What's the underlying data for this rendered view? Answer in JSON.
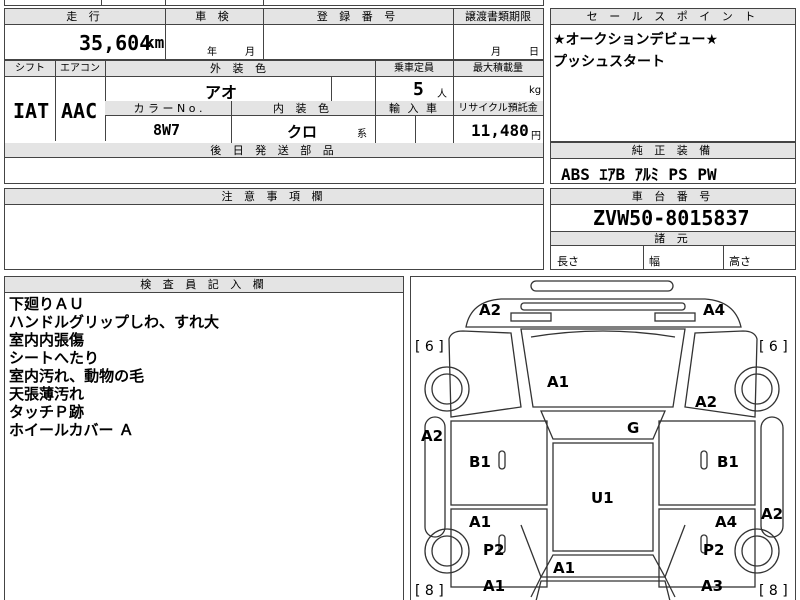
{
  "summary": {
    "mileage_label": "走 行",
    "inspection_label": "車 検",
    "registration_label": "登 録 番 号",
    "transfer_label": "譲渡書類期限",
    "mileage_value": "35,604",
    "mileage_unit": "km",
    "year_unit": "年",
    "month_unit": "月",
    "month_unit2": "月",
    "day_unit": "日"
  },
  "selling_point": {
    "label": "セ ー ル ス ポ イ ン ト",
    "line1": "★オークションデビュー★",
    "line2": "プッシュスタート"
  },
  "spec": {
    "shift_label": "シフト",
    "aircon_label": "エアコン",
    "exterior_color_label": "外 装 色",
    "capacity_label": "乗車定員",
    "max_load_label": "最大積載量",
    "shift_value": "IAT",
    "aircon_value": "AAC",
    "exterior_color_value": "アオ",
    "capacity_value": "5",
    "capacity_unit": "人",
    "max_load_unit": "kg",
    "color_no_label": "カ ラ ー N o .",
    "interior_color_label": "内 装 色",
    "import_label": "輸 入 車",
    "recycle_label": "リサイクル預託金",
    "color_no_value": "8W7",
    "interior_color_value": "クロ",
    "interior_color_suffix": "系",
    "recycle_value": "11,480",
    "recycle_unit": "円",
    "later_parts_label": "後 日 発 送 部 品"
  },
  "equipment": {
    "label": "純 正 装 備",
    "value": "ABS ｴｱB ｱﾙﾐ PS PW"
  },
  "caution": {
    "label": "注 意 事 項 欄"
  },
  "chassis": {
    "label": "車 台 番 号",
    "value": "ZVW50-8015837",
    "dimensions_label": "諸 元",
    "length_label": "長さ",
    "width_label": "幅",
    "height_label": "高さ"
  },
  "inspector": {
    "label": "検 査 員 記 入 欄",
    "notes": [
      "下廻りＡＵ",
      "ハンドルグリップしわ、すれ大",
      "室内内張傷",
      "シートへたり",
      "室内汚れ、動物の毛",
      "天張薄汚れ",
      "タッチＰ跡",
      "ホイールカバー Ａ"
    ]
  },
  "diagram": {
    "tire_fl": "[ 6 ]",
    "tire_fr": "[ 6 ]",
    "tire_rl": "[ 8 ]",
    "tire_rr": "[ 8 ]",
    "marks": {
      "front_bumper_left": "A2",
      "front_bumper_right": "A4",
      "hood": "A1",
      "fender_right": "A2",
      "fender_left_side": "A2",
      "roof_front": "G",
      "front_door_left": "B1",
      "front_door_right": "B1",
      "roof": "U1",
      "rear_door_left": "A1",
      "rear_door_right": "A4",
      "side_right": "A2",
      "pillar_left": "P2",
      "pillar_right": "P2",
      "trunk": "A1",
      "rear_left": "A1",
      "rear_right": "A3"
    }
  }
}
